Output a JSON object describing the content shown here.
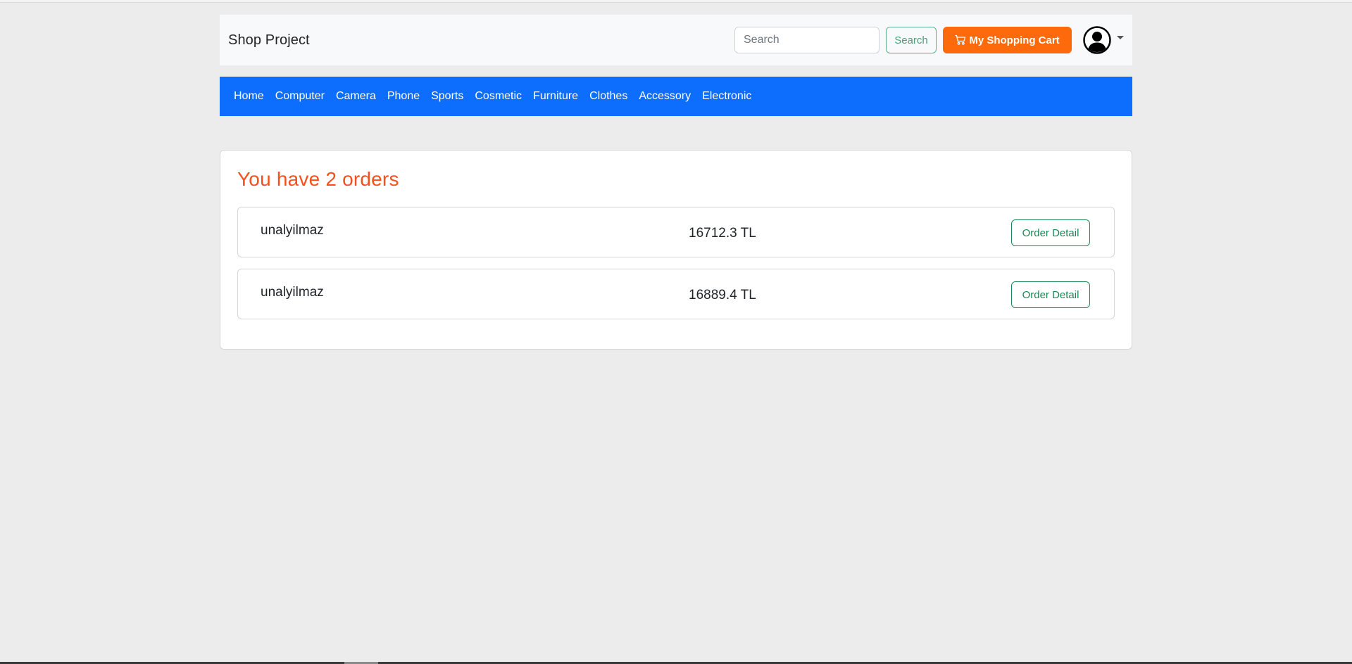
{
  "navbar": {
    "brand": "Shop Project",
    "search": {
      "placeholder": "Search",
      "value": ""
    },
    "search_button": "Search",
    "cart_button": "My Shopping Cart"
  },
  "categories": [
    "Home",
    "Computer",
    "Camera",
    "Phone",
    "Sports",
    "Cosmetic",
    "Furniture",
    "Clothes",
    "Accessory",
    "Electronic"
  ],
  "orders": {
    "title": "You have 2 orders",
    "items": [
      {
        "user": "unalyilmaz",
        "total": "16712.3 TL",
        "detail_label": "Order Detail"
      },
      {
        "user": "unalyilmaz",
        "total": "16889.4 TL",
        "detail_label": "Order Detail"
      }
    ]
  },
  "colors": {
    "category_bar": "#0d6efd",
    "cart_button": "#fd6a0b",
    "title": "#f4511e",
    "detail_button": "#198754"
  },
  "icons": {
    "cart": "cart-icon",
    "avatar": "user-avatar-icon",
    "caret": "chevron-down-icon"
  }
}
